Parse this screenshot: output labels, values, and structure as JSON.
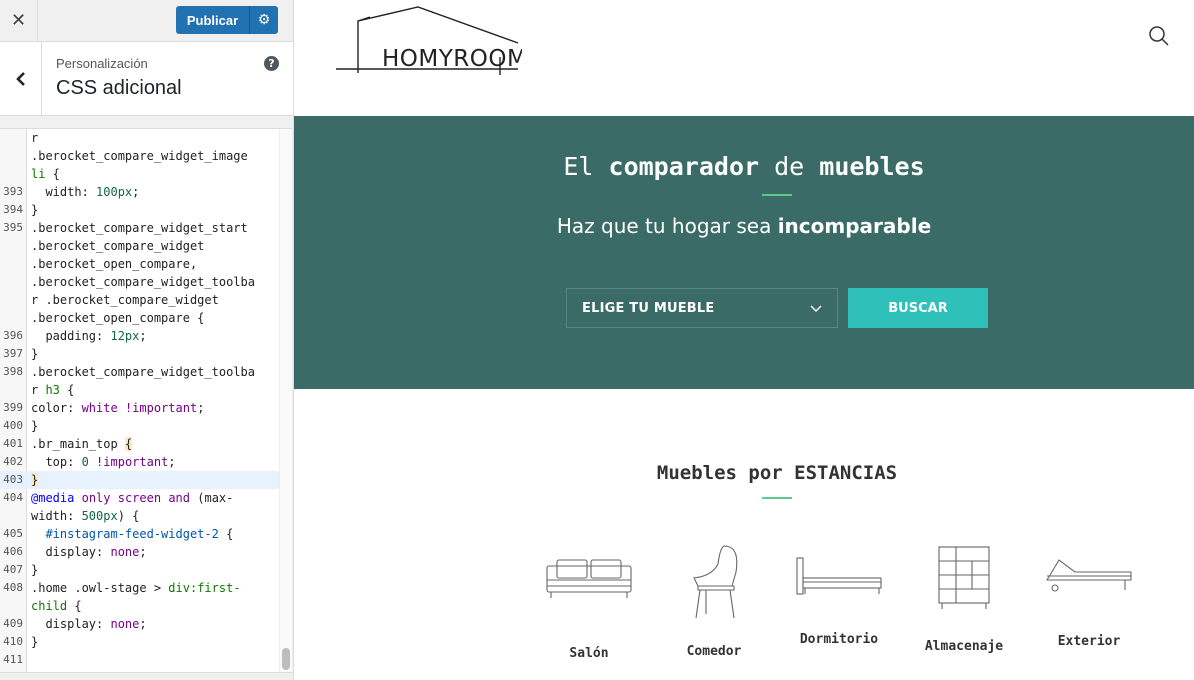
{
  "sidebar": {
    "close_symbol": "✕",
    "publish_label": "Publicar",
    "breadcrumb": "Personalización",
    "title": "CSS adicional",
    "help_symbol": "?"
  },
  "code_lines": [
    {
      "n": "",
      "html": "r"
    },
    {
      "n": "",
      "html": ".berocket_compare_widget_image"
    },
    {
      "n": "",
      "html": "<span class='tk-sel'>li</span> {"
    },
    {
      "n": "393",
      "html": "  width: <span class='tk-num'>100px</span>;"
    },
    {
      "n": "394",
      "html": "}"
    },
    {
      "n": "395",
      "html": ".berocket_compare_widget_start"
    },
    {
      "n": "",
      "html": ".berocket_compare_widget"
    },
    {
      "n": "",
      "html": ".berocket_open_compare,"
    },
    {
      "n": "",
      "html": ".berocket_compare_widget_toolba"
    },
    {
      "n": "",
      "html": "r .berocket_compare_widget"
    },
    {
      "n": "",
      "html": ".berocket_open_compare {"
    },
    {
      "n": "396",
      "html": "  padding: <span class='tk-num'>12px</span>;"
    },
    {
      "n": "397",
      "html": "}"
    },
    {
      "n": "398",
      "html": ".berocket_compare_widget_toolba"
    },
    {
      "n": "",
      "html": "r <span class='tk-sel'>h3</span> {"
    },
    {
      "n": "399",
      "html": "color: <span class='tk-kw'>white</span> <span class='tk-kw'>!important</span>;"
    },
    {
      "n": "400",
      "html": "}"
    },
    {
      "n": "401",
      "html": ".br_main_top <span class='brace-match'>{</span>"
    },
    {
      "n": "402",
      "html": "  top: <span class='tk-num'>0</span> <span class='tk-kw'>!important</span>;"
    },
    {
      "n": "403",
      "html": "<span class='brace-match'>}</span>",
      "active": true
    },
    {
      "n": "404",
      "html": "<span class='tk-def'>@media</span> <span class='tk-kw'>only</span> <span class='tk-kw'>screen</span> <span class='tk-kw'>and</span> (max-"
    },
    {
      "n": "",
      "html": "width: <span class='tk-num'>500px</span>) {"
    },
    {
      "n": "405",
      "html": "  <span class='tk-id'>#instagram-feed-widget-2</span> {"
    },
    {
      "n": "406",
      "html": "  display: <span class='tk-kw'>none</span>;"
    },
    {
      "n": "407",
      "html": "}"
    },
    {
      "n": "408",
      "html": ".home .owl-stage &gt; <span class='tk-sel'>div</span><span class='tk-sel'>:first-</span>"
    },
    {
      "n": "",
      "html": "<span class='tk-sel'>child</span> {"
    },
    {
      "n": "409",
      "html": "  display: <span class='tk-kw'>none</span>;"
    },
    {
      "n": "410",
      "html": "}"
    },
    {
      "n": "411",
      "html": ""
    }
  ],
  "preview": {
    "logo_text": "HOMYROOM",
    "hero": {
      "title_parts": [
        "El ",
        "comparador",
        " de ",
        "muebles"
      ],
      "subtitle_plain": "Haz que tu hogar sea ",
      "subtitle_bold": "incomparable",
      "select_label": "ELIGE TU MUEBLE",
      "search_button": "BUSCAR"
    },
    "rooms": {
      "title": "Muebles por ESTANCIAS",
      "items": [
        {
          "label": "Salón",
          "icon": "sofa-icon"
        },
        {
          "label": "Comedor",
          "icon": "chair-icon"
        },
        {
          "label": "Dormitorio",
          "icon": "bed-icon"
        },
        {
          "label": "Almacenaje",
          "icon": "shelf-icon"
        },
        {
          "label": "Exterior",
          "icon": "lounger-icon"
        }
      ]
    }
  },
  "colors": {
    "wp_blue": "#2271b1",
    "hero_bg": "#3b6b66",
    "accent_teal": "#2fc0b9",
    "accent_green": "#5ec98f"
  }
}
